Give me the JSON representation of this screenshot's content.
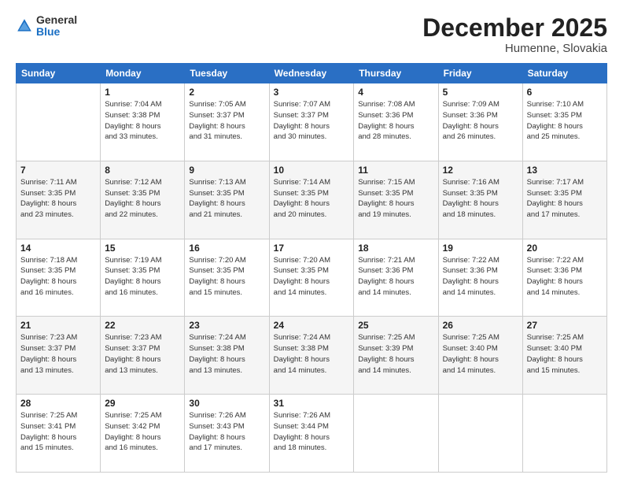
{
  "header": {
    "logo_general": "General",
    "logo_blue": "Blue",
    "month_title": "December 2025",
    "location": "Humenne, Slovakia"
  },
  "days_of_week": [
    "Sunday",
    "Monday",
    "Tuesday",
    "Wednesday",
    "Thursday",
    "Friday",
    "Saturday"
  ],
  "weeks": [
    [
      {
        "day": "",
        "info": ""
      },
      {
        "day": "1",
        "info": "Sunrise: 7:04 AM\nSunset: 3:38 PM\nDaylight: 8 hours\nand 33 minutes."
      },
      {
        "day": "2",
        "info": "Sunrise: 7:05 AM\nSunset: 3:37 PM\nDaylight: 8 hours\nand 31 minutes."
      },
      {
        "day": "3",
        "info": "Sunrise: 7:07 AM\nSunset: 3:37 PM\nDaylight: 8 hours\nand 30 minutes."
      },
      {
        "day": "4",
        "info": "Sunrise: 7:08 AM\nSunset: 3:36 PM\nDaylight: 8 hours\nand 28 minutes."
      },
      {
        "day": "5",
        "info": "Sunrise: 7:09 AM\nSunset: 3:36 PM\nDaylight: 8 hours\nand 26 minutes."
      },
      {
        "day": "6",
        "info": "Sunrise: 7:10 AM\nSunset: 3:35 PM\nDaylight: 8 hours\nand 25 minutes."
      }
    ],
    [
      {
        "day": "7",
        "info": "Sunrise: 7:11 AM\nSunset: 3:35 PM\nDaylight: 8 hours\nand 23 minutes."
      },
      {
        "day": "8",
        "info": "Sunrise: 7:12 AM\nSunset: 3:35 PM\nDaylight: 8 hours\nand 22 minutes."
      },
      {
        "day": "9",
        "info": "Sunrise: 7:13 AM\nSunset: 3:35 PM\nDaylight: 8 hours\nand 21 minutes."
      },
      {
        "day": "10",
        "info": "Sunrise: 7:14 AM\nSunset: 3:35 PM\nDaylight: 8 hours\nand 20 minutes."
      },
      {
        "day": "11",
        "info": "Sunrise: 7:15 AM\nSunset: 3:35 PM\nDaylight: 8 hours\nand 19 minutes."
      },
      {
        "day": "12",
        "info": "Sunrise: 7:16 AM\nSunset: 3:35 PM\nDaylight: 8 hours\nand 18 minutes."
      },
      {
        "day": "13",
        "info": "Sunrise: 7:17 AM\nSunset: 3:35 PM\nDaylight: 8 hours\nand 17 minutes."
      }
    ],
    [
      {
        "day": "14",
        "info": "Sunrise: 7:18 AM\nSunset: 3:35 PM\nDaylight: 8 hours\nand 16 minutes."
      },
      {
        "day": "15",
        "info": "Sunrise: 7:19 AM\nSunset: 3:35 PM\nDaylight: 8 hours\nand 16 minutes."
      },
      {
        "day": "16",
        "info": "Sunrise: 7:20 AM\nSunset: 3:35 PM\nDaylight: 8 hours\nand 15 minutes."
      },
      {
        "day": "17",
        "info": "Sunrise: 7:20 AM\nSunset: 3:35 PM\nDaylight: 8 hours\nand 14 minutes."
      },
      {
        "day": "18",
        "info": "Sunrise: 7:21 AM\nSunset: 3:36 PM\nDaylight: 8 hours\nand 14 minutes."
      },
      {
        "day": "19",
        "info": "Sunrise: 7:22 AM\nSunset: 3:36 PM\nDaylight: 8 hours\nand 14 minutes."
      },
      {
        "day": "20",
        "info": "Sunrise: 7:22 AM\nSunset: 3:36 PM\nDaylight: 8 hours\nand 14 minutes."
      }
    ],
    [
      {
        "day": "21",
        "info": "Sunrise: 7:23 AM\nSunset: 3:37 PM\nDaylight: 8 hours\nand 13 minutes."
      },
      {
        "day": "22",
        "info": "Sunrise: 7:23 AM\nSunset: 3:37 PM\nDaylight: 8 hours\nand 13 minutes."
      },
      {
        "day": "23",
        "info": "Sunrise: 7:24 AM\nSunset: 3:38 PM\nDaylight: 8 hours\nand 13 minutes."
      },
      {
        "day": "24",
        "info": "Sunrise: 7:24 AM\nSunset: 3:38 PM\nDaylight: 8 hours\nand 14 minutes."
      },
      {
        "day": "25",
        "info": "Sunrise: 7:25 AM\nSunset: 3:39 PM\nDaylight: 8 hours\nand 14 minutes."
      },
      {
        "day": "26",
        "info": "Sunrise: 7:25 AM\nSunset: 3:40 PM\nDaylight: 8 hours\nand 14 minutes."
      },
      {
        "day": "27",
        "info": "Sunrise: 7:25 AM\nSunset: 3:40 PM\nDaylight: 8 hours\nand 15 minutes."
      }
    ],
    [
      {
        "day": "28",
        "info": "Sunrise: 7:25 AM\nSunset: 3:41 PM\nDaylight: 8 hours\nand 15 minutes."
      },
      {
        "day": "29",
        "info": "Sunrise: 7:25 AM\nSunset: 3:42 PM\nDaylight: 8 hours\nand 16 minutes."
      },
      {
        "day": "30",
        "info": "Sunrise: 7:26 AM\nSunset: 3:43 PM\nDaylight: 8 hours\nand 17 minutes."
      },
      {
        "day": "31",
        "info": "Sunrise: 7:26 AM\nSunset: 3:44 PM\nDaylight: 8 hours\nand 18 minutes."
      },
      {
        "day": "",
        "info": ""
      },
      {
        "day": "",
        "info": ""
      },
      {
        "day": "",
        "info": ""
      }
    ]
  ]
}
